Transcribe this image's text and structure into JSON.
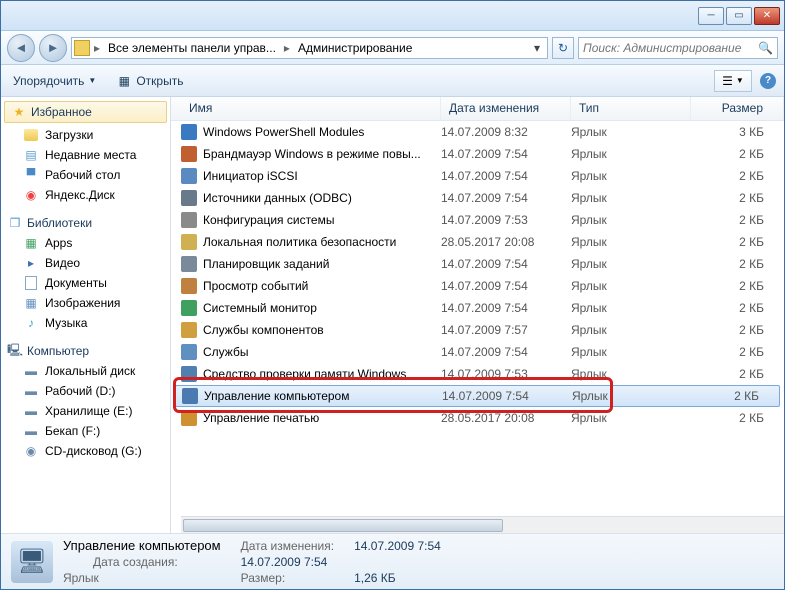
{
  "address": {
    "seg1": "Все элементы панели управ...",
    "seg2": "Администрирование"
  },
  "search": {
    "placeholder": "Поиск: Администрирование"
  },
  "toolbar": {
    "organize": "Упорядочить",
    "open": "Открыть"
  },
  "sidebar": {
    "favorites": {
      "header": "Избранное",
      "items": [
        "Загрузки",
        "Недавние места",
        "Рабочий стол",
        "Яндекс.Диск"
      ]
    },
    "libraries": {
      "header": "Библиотеки",
      "items": [
        "Apps",
        "Видео",
        "Документы",
        "Изображения",
        "Музыка"
      ]
    },
    "computer": {
      "header": "Компьютер",
      "items": [
        "Локальный диск",
        "Рабочий (D:)",
        "Хранилище (E:)",
        "Бекап (F:)",
        "CD-дисковод (G:)"
      ]
    }
  },
  "columns": {
    "name": "Имя",
    "date": "Дата изменения",
    "type": "Тип",
    "size": "Размер"
  },
  "rows": [
    {
      "name": "Windows PowerShell Modules",
      "date": "14.07.2009 8:32",
      "type": "Ярлык",
      "size": "3 КБ",
      "color": "#3a7ac0"
    },
    {
      "name": "Брандмауэр Windows в режиме повы...",
      "date": "14.07.2009 7:54",
      "type": "Ярлык",
      "size": "2 КБ",
      "color": "#c06030"
    },
    {
      "name": "Инициатор iSCSI",
      "date": "14.07.2009 7:54",
      "type": "Ярлык",
      "size": "2 КБ",
      "color": "#5a8ac0"
    },
    {
      "name": "Источники данных (ODBC)",
      "date": "14.07.2009 7:54",
      "type": "Ярлык",
      "size": "2 КБ",
      "color": "#6a7a8a"
    },
    {
      "name": "Конфигурация системы",
      "date": "14.07.2009 7:53",
      "type": "Ярлык",
      "size": "2 КБ",
      "color": "#8a8a8a"
    },
    {
      "name": "Локальная политика безопасности",
      "date": "28.05.2017 20:08",
      "type": "Ярлык",
      "size": "2 КБ",
      "color": "#d0b050"
    },
    {
      "name": "Планировщик заданий",
      "date": "14.07.2009 7:54",
      "type": "Ярлык",
      "size": "2 КБ",
      "color": "#7a8a9a"
    },
    {
      "name": "Просмотр событий",
      "date": "14.07.2009 7:54",
      "type": "Ярлык",
      "size": "2 КБ",
      "color": "#c08040"
    },
    {
      "name": "Системный монитор",
      "date": "14.07.2009 7:54",
      "type": "Ярлык",
      "size": "2 КБ",
      "color": "#40a060"
    },
    {
      "name": "Службы компонентов",
      "date": "14.07.2009 7:57",
      "type": "Ярлык",
      "size": "2 КБ",
      "color": "#d0a040"
    },
    {
      "name": "Службы",
      "date": "14.07.2009 7:54",
      "type": "Ярлык",
      "size": "2 КБ",
      "color": "#6090c0"
    },
    {
      "name": "Средство проверки памяти Windows",
      "date": "14.07.2009 7:53",
      "type": "Ярлык",
      "size": "2 КБ",
      "color": "#5080b0"
    },
    {
      "name": "Управление компьютером",
      "date": "14.07.2009 7:54",
      "type": "Ярлык",
      "size": "2 КБ",
      "color": "#4a7ab0",
      "selected": true
    },
    {
      "name": "Управление печатью",
      "date": "28.05.2017 20:08",
      "type": "Ярлык",
      "size": "2 КБ",
      "color": "#d09030"
    }
  ],
  "details": {
    "title": "Управление компьютером",
    "type": "Ярлык",
    "modLabel": "Дата изменения:",
    "modVal": "14.07.2009 7:54",
    "createdLabel": "Дата создания:",
    "createdVal": "14.07.2009 7:54",
    "sizeLabel": "Размер:",
    "sizeVal": "1,26 КБ"
  }
}
